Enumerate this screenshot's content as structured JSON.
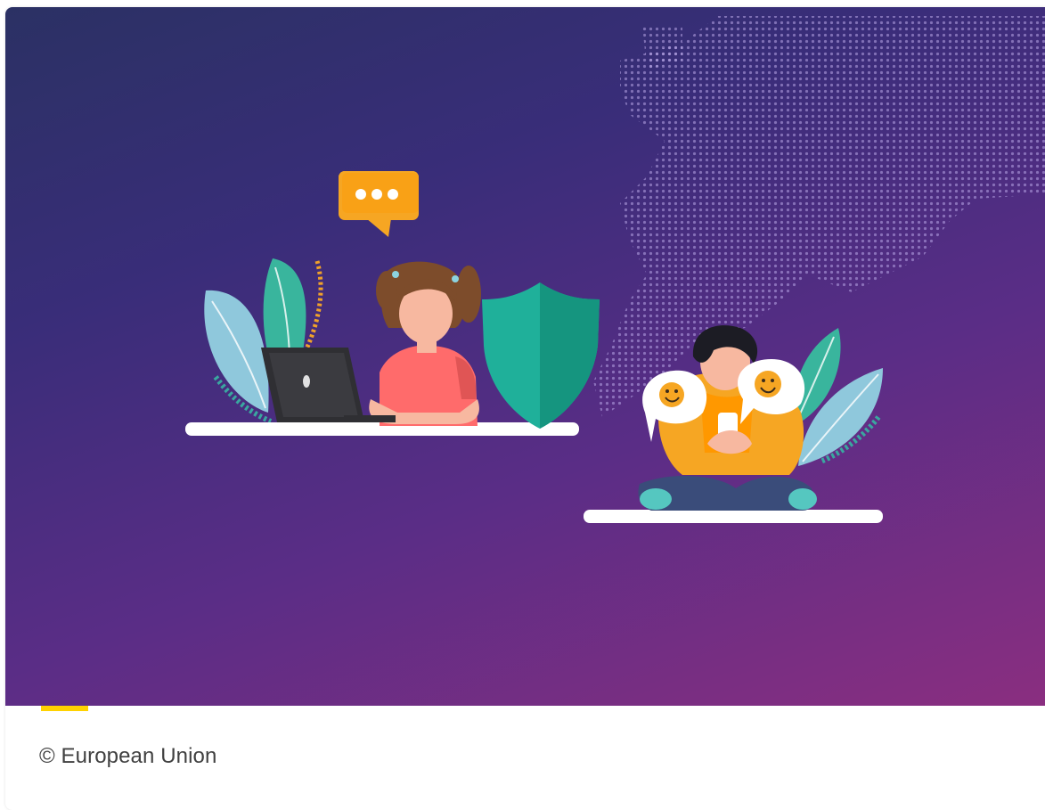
{
  "media": {
    "caption": "© European Union",
    "image_alt": "Illustration of a girl using a laptop next to a shield and a boy holding a phone with smiley speech bubbles, over a dotted map of Europe"
  },
  "colors": {
    "accent": "#ffd200",
    "gradient_start": "#2b3164",
    "gradient_end": "#8a2e80",
    "caption_text": "#404040"
  },
  "icons": [
    "chat-bubble-icon",
    "shield-icon",
    "laptop-icon",
    "phone-icon",
    "smiley-icon"
  ]
}
